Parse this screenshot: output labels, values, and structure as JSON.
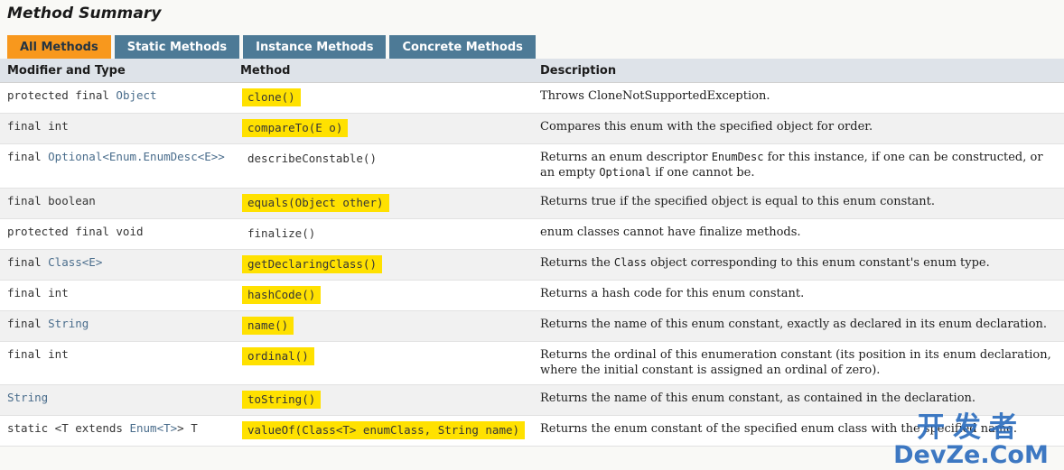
{
  "page": {
    "title": "Method Summary",
    "background": "#f9f9f6"
  },
  "tabs": {
    "active_index": 0,
    "active_color": "#f8981d",
    "inactive_color": "#4d7a96",
    "items": [
      {
        "label": "All Methods"
      },
      {
        "label": "Static Methods"
      },
      {
        "label": "Instance Methods"
      },
      {
        "label": "Concrete Methods"
      }
    ]
  },
  "table": {
    "headers": {
      "modifier": "Modifier and Type",
      "method": "Method",
      "description": "Description"
    },
    "highlight_color": "#ffe100",
    "rows": [
      {
        "modifier": "protected final Object",
        "modifier_link": "Object",
        "method": "clone()",
        "highlighted": true,
        "description": "Throws CloneNotSupportedException."
      },
      {
        "modifier": "final int",
        "modifier_link": "",
        "method": "compareTo(E o)",
        "highlighted": true,
        "description": "Compares this enum with the specified object for order."
      },
      {
        "modifier": "final Optional<Enum.EnumDesc<E>>",
        "modifier_link": "Optional<Enum.EnumDesc<E>>",
        "method": "describeConstable()",
        "highlighted": false,
        "description": "Returns an enum descriptor EnumDesc for this instance, if one can be constructed, or an empty Optional if one cannot be."
      },
      {
        "modifier": "final boolean",
        "modifier_link": "",
        "method": "equals(Object other)",
        "highlighted": true,
        "description": "Returns true if the specified object is equal to this enum constant."
      },
      {
        "modifier": "protected final void",
        "modifier_link": "",
        "method": "finalize()",
        "highlighted": false,
        "description": "enum classes cannot have finalize methods."
      },
      {
        "modifier": "final Class<E>",
        "modifier_link": "Class<E>",
        "method": "getDeclaringClass()",
        "highlighted": true,
        "description": "Returns the Class object corresponding to this enum constant's enum type."
      },
      {
        "modifier": "final int",
        "modifier_link": "",
        "method": "hashCode()",
        "highlighted": true,
        "description": "Returns a hash code for this enum constant."
      },
      {
        "modifier": "final String",
        "modifier_link": "String",
        "method": "name()",
        "highlighted": true,
        "description": "Returns the name of this enum constant, exactly as declared in its enum declaration."
      },
      {
        "modifier": "final int",
        "modifier_link": "",
        "method": "ordinal()",
        "highlighted": true,
        "description": "Returns the ordinal of this enumeration constant (its position in its enum declaration, where the initial constant is assigned an ordinal of zero)."
      },
      {
        "modifier": "String",
        "modifier_link": "String",
        "method": "toString()",
        "highlighted": true,
        "description": "Returns the name of this enum constant, as contained in the declaration."
      },
      {
        "modifier": "static <T extends Enum<T>> T",
        "modifier_link": "Enum<T>",
        "method": "valueOf(Class<T> enumClass, String name)",
        "highlighted": true,
        "description": "Returns the enum constant of the specified enum class with the specified name."
      }
    ]
  },
  "watermark": {
    "chinese": "开发者",
    "latin": "DevZe.CoM",
    "color": "#2f6fbf"
  }
}
